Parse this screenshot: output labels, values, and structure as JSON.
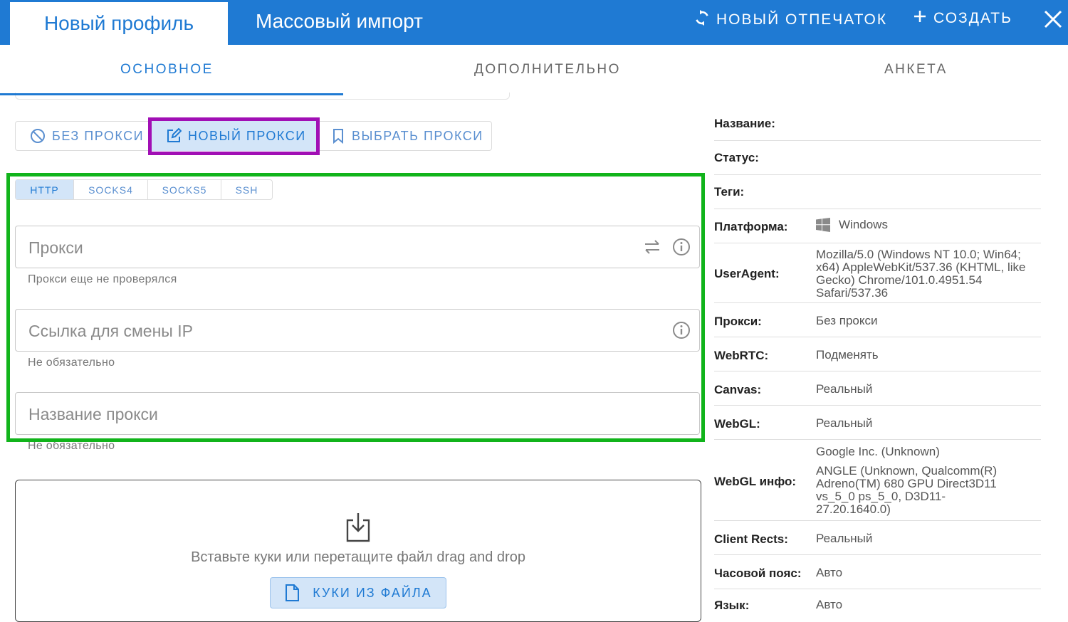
{
  "header": {
    "tab_new_profile": "Новый профиль",
    "tab_mass_import": "Массовый импорт",
    "new_fingerprint": "НОВЫЙ ОТПЕЧАТОК",
    "create": "СОЗДАТЬ"
  },
  "subtabs": [
    "ОСНОВНОЕ",
    "ДОПОЛНИТЕЛЬНО",
    "АНКЕТА"
  ],
  "proxy_mode": {
    "none": "БЕЗ ПРОКСИ",
    "new": "НОВЫЙ ПРОКСИ",
    "select": "ВЫБРАТЬ ПРОКСИ",
    "selected": "new"
  },
  "protocols": [
    "HTTP",
    "SOCKS4",
    "SOCKS5",
    "SSH"
  ],
  "fields": {
    "proxy": {
      "placeholder": "Прокси",
      "hint": "Прокси еще не проверялся"
    },
    "change_ip": {
      "placeholder": "Ссылка для смены IP",
      "hint": "Не обязательно"
    },
    "proxy_name": {
      "placeholder": "Название прокси",
      "hint": "Не обязательно"
    }
  },
  "cookies": {
    "text": "Вставьте куки или перетащите файл drag and drop",
    "button": "КУКИ ИЗ ФАЙЛА"
  },
  "summary": {
    "name_label": "Название:",
    "status_label": "Статус:",
    "tags_label": "Теги:",
    "platform_label": "Платформа:",
    "platform_value": "Windows",
    "ua_label": "UserAgent:",
    "ua_line1": "Mozilla/5.0 (Windows NT 10.0; Win64;",
    "ua_line2": "x64) AppleWebKit/537.36 (KHTML, like",
    "ua_line3": "Gecko) Chrome/101.0.4951.54",
    "ua_line4": "Safari/537.36",
    "proxy_label": "Прокси:",
    "proxy_value": "Без прокси",
    "webrtc_label": "WebRTC:",
    "webrtc_value": "Подменять",
    "canvas_label": "Canvas:",
    "canvas_value": "Реальный",
    "webgl_label": "WebGL:",
    "webgl_value": "Реальный",
    "webgl_info_label": "WebGL инфо:",
    "webgl_vendor": "Google Inc. (Unknown)",
    "webgl_r1": "ANGLE (Unknown, Qualcomm(R)",
    "webgl_r2": "Adreno(TM) 680 GPU Direct3D11",
    "webgl_r3": "vs_5_0 ps_5_0, D3D11-",
    "webgl_r4": "27.20.1640.0)",
    "client_rects_label": "Client Rects:",
    "client_rects_value": "Реальный",
    "timezone_label": "Часовой пояс:",
    "timezone_value": "Авто",
    "language_label": "Язык:",
    "language_value": "Авто"
  },
  "colors": {
    "brand_blue": "#1f7ad3",
    "selected_bg": "#d3e5f8",
    "annotation_purple": "#a10fb5",
    "annotation_green": "#11b41b"
  }
}
